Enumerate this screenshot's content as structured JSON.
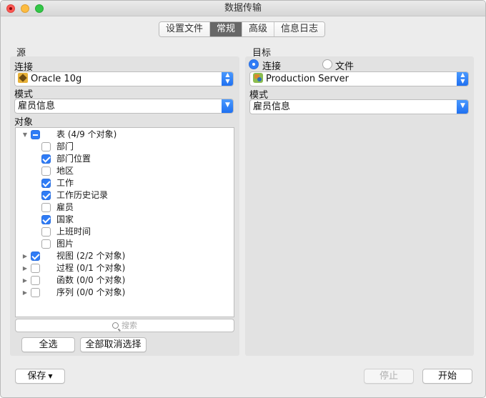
{
  "window": {
    "title": "数据传输"
  },
  "tabs": [
    {
      "label": "设置文件",
      "active": false
    },
    {
      "label": "常规",
      "active": true
    },
    {
      "label": "高级",
      "active": false
    },
    {
      "label": "信息日志",
      "active": false
    }
  ],
  "source": {
    "section_label": "源",
    "connection_label": "连接",
    "connection_value": "Oracle 10g",
    "connection_icon": "oracle-db-icon",
    "schema_label": "模式",
    "schema_value": "雇员信息",
    "objects_label": "对象",
    "tree": [
      {
        "label": "表 (4/9 个对象)",
        "expanded": true,
        "state": "mixed"
      },
      {
        "label": "部门",
        "state": "unchecked"
      },
      {
        "label": "部门位置",
        "state": "checked"
      },
      {
        "label": "地区",
        "state": "unchecked"
      },
      {
        "label": "工作",
        "state": "checked"
      },
      {
        "label": "工作历史记录",
        "state": "checked"
      },
      {
        "label": "雇员",
        "state": "unchecked"
      },
      {
        "label": "国家",
        "state": "checked"
      },
      {
        "label": "上班时间",
        "state": "unchecked"
      },
      {
        "label": "图片",
        "state": "unchecked"
      },
      {
        "label": "视图 (2/2 个对象)",
        "expanded": false,
        "state": "checked"
      },
      {
        "label": "过程 (0/1 个对象)",
        "expanded": false,
        "state": "unchecked"
      },
      {
        "label": "函数 (0/0 个对象)",
        "expanded": false,
        "state": "unchecked"
      },
      {
        "label": "序列 (0/0 个对象)",
        "expanded": false,
        "state": "unchecked"
      }
    ],
    "search_placeholder": "搜索",
    "select_all_label": "全选",
    "deselect_all_label": "全部取消选择"
  },
  "target": {
    "section_label": "目标",
    "radio_connection_label": "连接",
    "radio_file_label": "文件",
    "selected_mode": "连接",
    "connection_value": "Production Server",
    "connection_icon": "server-icon",
    "schema_label": "模式",
    "schema_value": "雇员信息"
  },
  "footer": {
    "save_label": "保存",
    "stop_label": "停止",
    "start_label": "开始"
  },
  "colors": {
    "accent": "#2f7cf6",
    "panel": "#e2e2e2",
    "window_bg": "#ececec"
  }
}
